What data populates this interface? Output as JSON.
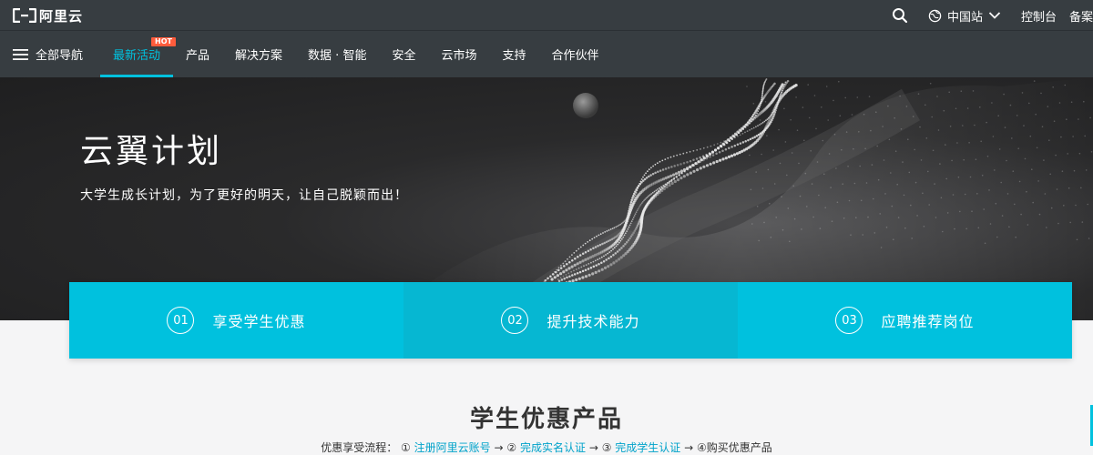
{
  "brand": {
    "name": "阿里云"
  },
  "topbar": {
    "region": "中国站",
    "links": [
      "控制台",
      "备案"
    ]
  },
  "nav": {
    "all_label": "全部导航",
    "items": [
      {
        "label": "最新活动",
        "badge": "HOT"
      },
      {
        "label": "产品"
      },
      {
        "label": "解决方案"
      },
      {
        "label": "数据 · 智能"
      },
      {
        "label": "安全"
      },
      {
        "label": "云市场"
      },
      {
        "label": "支持"
      },
      {
        "label": "合作伙伴"
      }
    ]
  },
  "hero": {
    "title": "云翼计划",
    "subtitle": "大学生成长计划，为了更好的明天，让自己脱颖而出！"
  },
  "steps": [
    {
      "num": "01",
      "label": "享受学生优惠"
    },
    {
      "num": "02",
      "label": "提升技术能力"
    },
    {
      "num": "03",
      "label": "应聘推荐岗位"
    }
  ],
  "section": {
    "title": "学生优惠产品",
    "flow_prefix": "优惠享受流程：",
    "flow_step1_num": "①",
    "flow_step1": "注册阿里云账号",
    "flow_arrow1": "→",
    "flow_step2_num": "②",
    "flow_step2": "完成实名认证",
    "flow_arrow2": "→",
    "flow_step3_num": "③",
    "flow_step3": "完成学生认证",
    "flow_arrow3": "→",
    "flow_step4": "④购买优惠产品"
  },
  "colors": {
    "accent": "#00c1de",
    "header_bg": "#373d41",
    "hot": "#ff5c3c",
    "link": "#00a2ca"
  },
  "icons": {
    "logo": "aliyun-logo-icon",
    "search": "search-icon",
    "globe": "globe-icon",
    "chevron": "chevron-down-icon",
    "menu": "hamburger-menu-icon"
  }
}
